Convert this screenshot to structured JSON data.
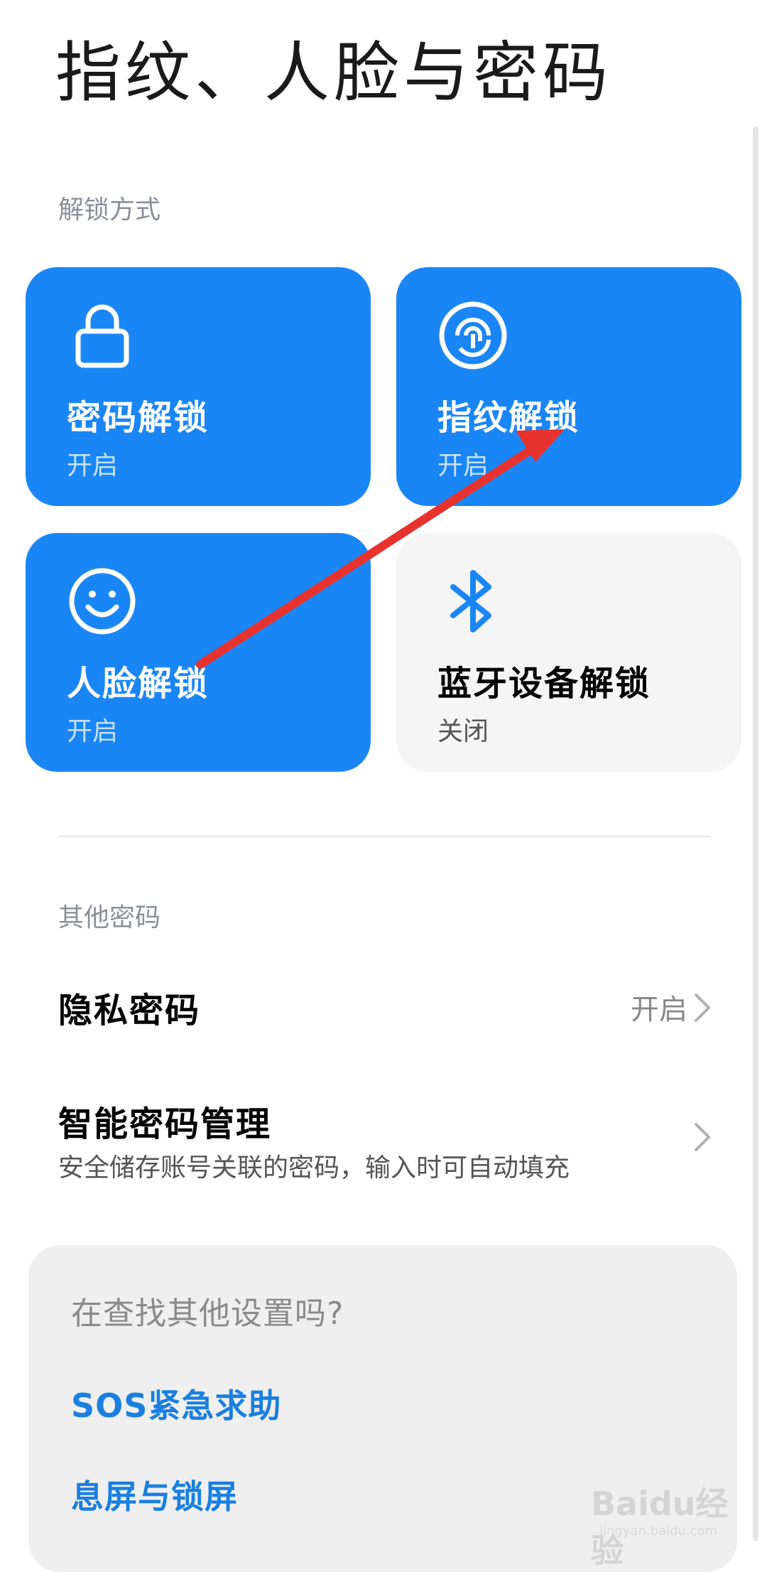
{
  "header": {
    "title": "指纹、人脸与密码"
  },
  "unlock_section": {
    "label": "解锁方式",
    "tiles": [
      {
        "title": "密码解锁",
        "status": "开启",
        "icon": "lock-icon",
        "enabled": true
      },
      {
        "title": "指纹解锁",
        "status": "开启",
        "icon": "fingerprint-icon",
        "enabled": true
      },
      {
        "title": "人脸解锁",
        "status": "开启",
        "icon": "face-icon",
        "enabled": true
      },
      {
        "title": "蓝牙设备解锁",
        "status": "关闭",
        "icon": "bluetooth-icon",
        "enabled": false
      }
    ]
  },
  "other_section": {
    "label": "其他密码",
    "items": [
      {
        "title": "隐私密码",
        "value": "开启"
      },
      {
        "title": "智能密码管理",
        "subtitle": "安全储存账号关联的密码，输入时可自动填充"
      }
    ]
  },
  "suggestions": {
    "title": "在查找其他设置吗?",
    "links": [
      "SOS紧急求助",
      "息屏与锁屏"
    ]
  },
  "watermark": {
    "text": "Baidu经验",
    "sub": "jingyan.baidu.com"
  },
  "colors": {
    "accent": "#1a86f6",
    "link": "#1a7fe0",
    "annotation_arrow": "#e8322d"
  }
}
